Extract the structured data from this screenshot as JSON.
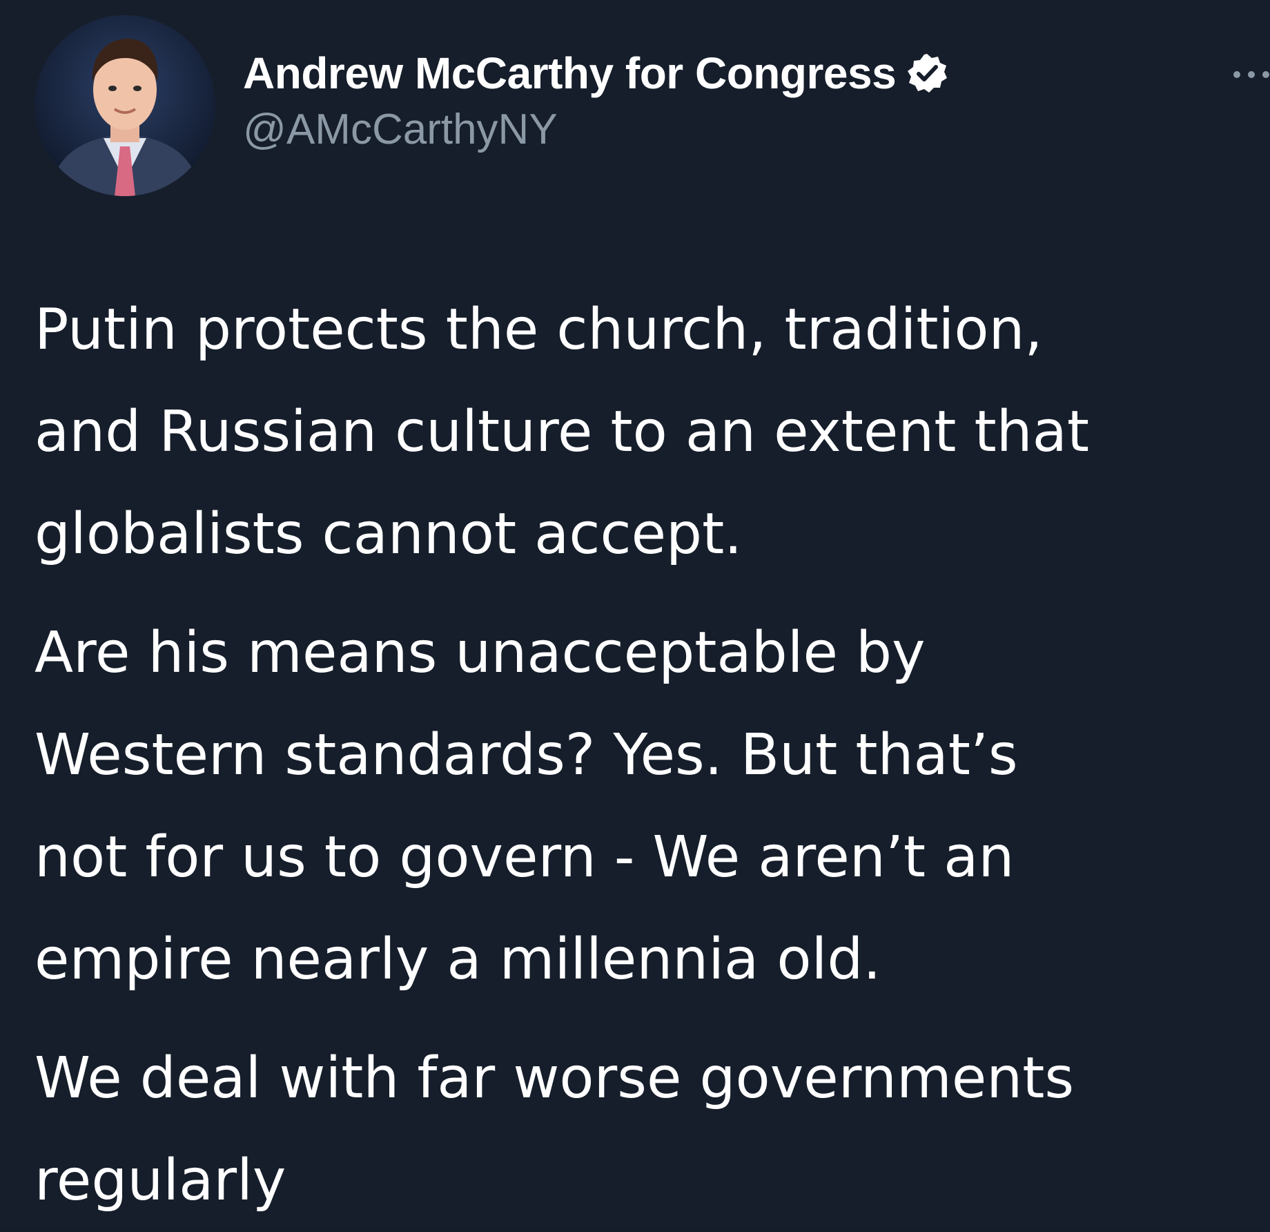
{
  "tweet": {
    "author": {
      "display_name": "Andrew McCarthy for Congress",
      "handle": "@AMcCarthyNY",
      "verified": true
    },
    "paragraphs": [
      [
        "Putin protects the church, tradition,",
        "and Russian culture to an extent that",
        "globalists cannot accept."
      ],
      [
        "Are his means unacceptable by",
        "Western standards? Yes. But that’s",
        "not for us to govern - We aren’t an",
        "empire nearly a millennia old."
      ],
      [
        "We deal with far worse governments",
        "regularly"
      ]
    ]
  },
  "icons": {
    "avatar": "profile-photo",
    "verified": "verified-badge-icon",
    "more": "more-options-icon"
  },
  "colors": {
    "background": "#161e2b",
    "primary_text": "#ffffff",
    "secondary_text": "#8b98a5"
  }
}
